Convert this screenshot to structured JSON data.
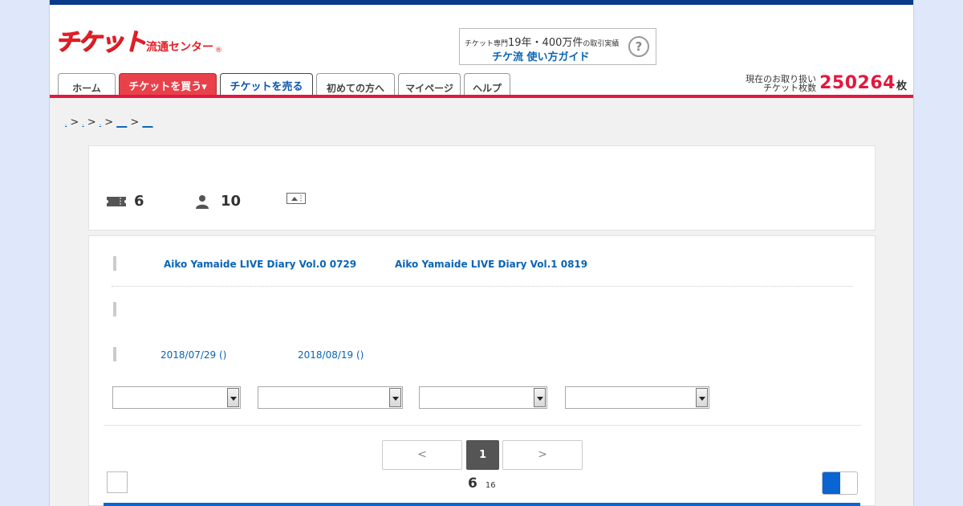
{
  "header": {
    "logo_main": "チケット",
    "logo_sub": "流通センター",
    "logo_mark": "®",
    "guide": {
      "top_prefix": "チケット専門",
      "top_big": "19年・400万件",
      "top_suffix": "の取引実績",
      "main": "チケ流 使い方ガイド",
      "help_symbol": "?"
    },
    "tabs": [
      {
        "label": "ホーム"
      },
      {
        "label": "チケットを買う▾"
      },
      {
        "label": "チケットを売る"
      },
      {
        "label": "初めての方へ"
      },
      {
        "label": "マイページ"
      },
      {
        "label": "ヘルプ"
      }
    ],
    "ticket_count": {
      "label_line1": "現在のお取り扱い",
      "label_line2": "チケット枚数",
      "value": "250264",
      "unit": "枚"
    }
  },
  "breadcrumb": {
    "items": [
      ".",
      ".",
      ".",
      "__",
      "__"
    ],
    "separator": ">"
  },
  "summary": {
    "tickets_count": "6",
    "people_count": "10"
  },
  "events": {
    "titles": [
      "Aiko Yamaide LIVE Diary Vol.0 0729",
      "Aiko Yamaide LIVE Diary Vol.1 0819"
    ],
    "dates": [
      "2018/07/29 ()",
      "2018/08/19 ()"
    ]
  },
  "pagination": {
    "prev": "<",
    "current": "1",
    "next": ">"
  },
  "results": {
    "count": "6",
    "sub": "16"
  },
  "colors": {
    "brand_red": "#e3183c",
    "link_blue": "#0a64b4",
    "navy": "#0a3a8a",
    "accent_blue": "#0a64d2"
  }
}
